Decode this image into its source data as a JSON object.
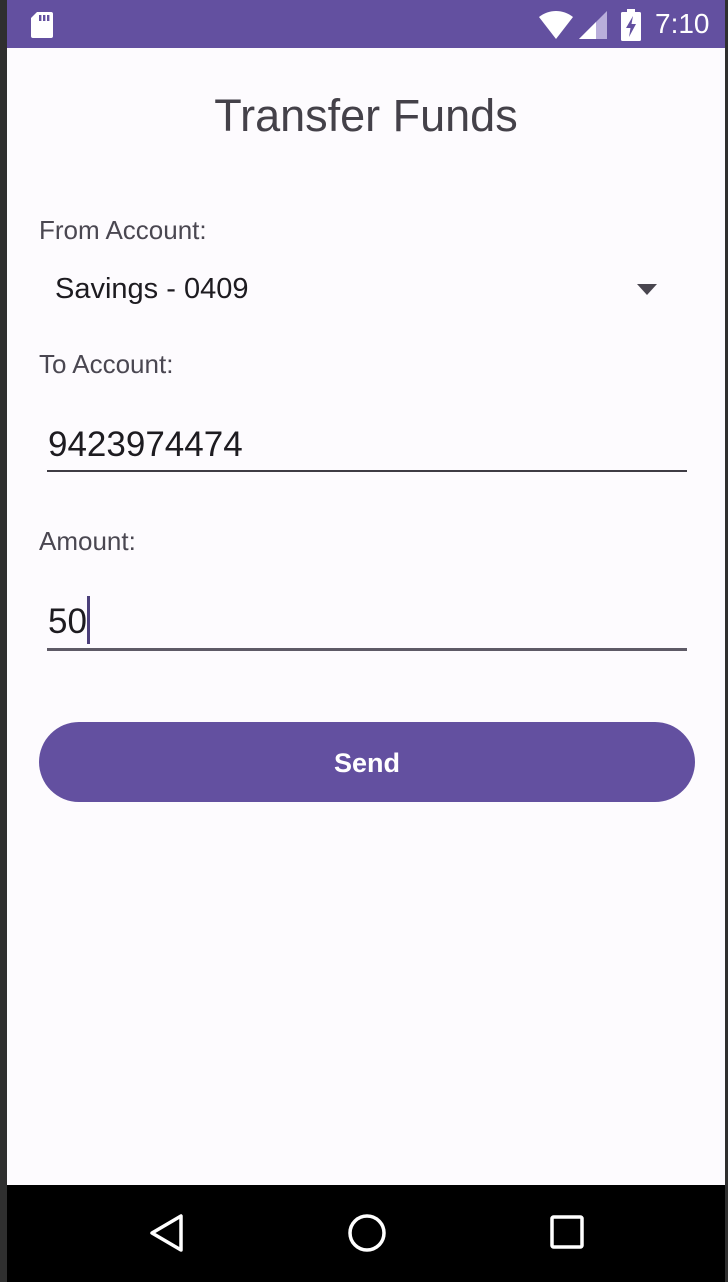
{
  "status_bar": {
    "time": "7:10",
    "icons": [
      "sd-card-icon",
      "wifi-icon",
      "cell-signal-icon",
      "battery-charging-icon"
    ],
    "background_color": "#6350a0"
  },
  "page": {
    "title": "Transfer Funds"
  },
  "form": {
    "from_label": "From Account:",
    "from_selected": "Savings - 0409",
    "to_label": "To Account:",
    "to_value": "9423974474",
    "amount_label": "Amount:",
    "amount_value": "50",
    "send_label": "Send"
  },
  "nav_bar": {
    "buttons": [
      "back-icon",
      "home-icon",
      "recents-icon"
    ]
  },
  "colors": {
    "accent": "#6350a0",
    "background": "#fdfbfe",
    "text": "#1d1b20",
    "label": "#4a4751"
  }
}
